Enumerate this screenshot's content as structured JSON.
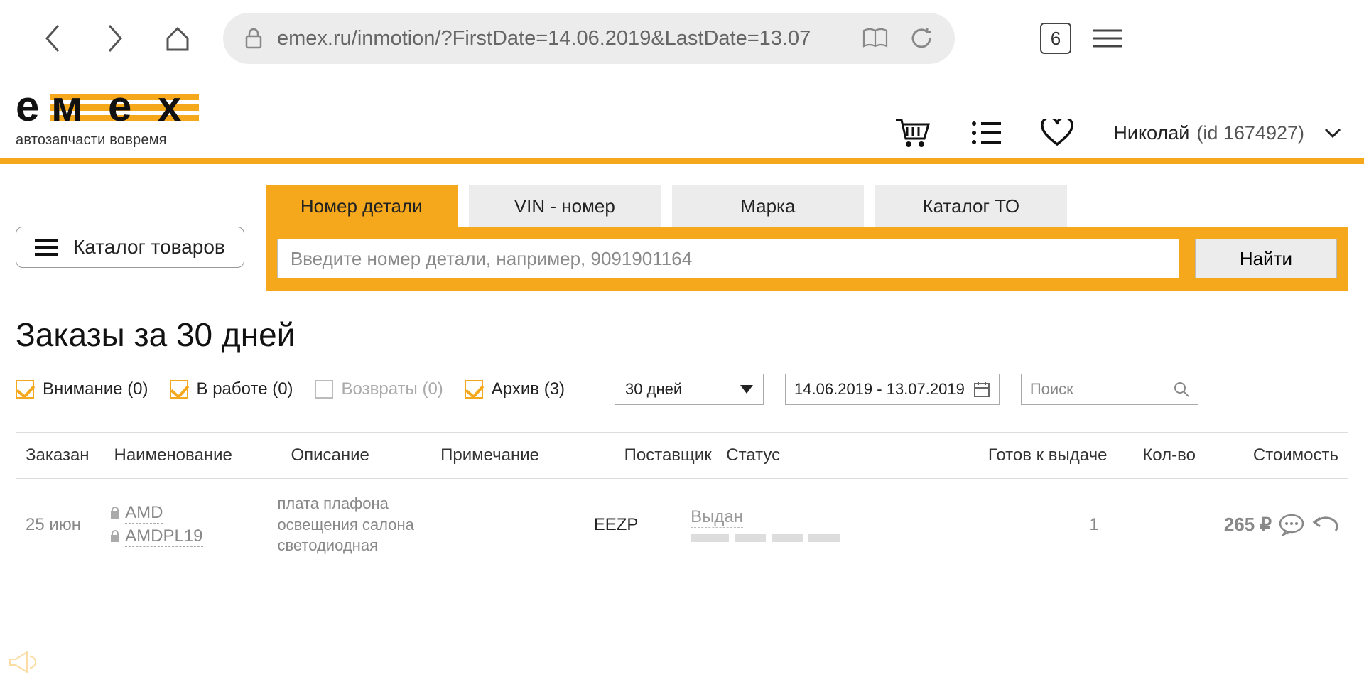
{
  "browser": {
    "url": "emex.ru/inmotion/?FirstDate=14.06.2019&LastDate=13.07",
    "tab_count": "6"
  },
  "logo": {
    "text": "емех",
    "tagline": "автозапчасти вовремя"
  },
  "header": {
    "user_name": "Николай",
    "user_id": "(id 1674927)"
  },
  "catalog_button": "Каталог товаров",
  "tabs": [
    "Номер детали",
    "VIN - номер",
    "Марка",
    "Каталог ТО"
  ],
  "search": {
    "placeholder": "Введите номер детали, например, 9091901164",
    "button": "Найти"
  },
  "page_title": "Заказы за 30 дней",
  "filters": {
    "attention": "Внимание (0)",
    "in_work": "В работе (0)",
    "returns": "Возвраты (0)",
    "archive": "Архив (3)",
    "period": "30 дней",
    "date_range": "14.06.2019 - 13.07.2019",
    "search_placeholder": "Поиск"
  },
  "table": {
    "headers": {
      "date": "Заказан",
      "name": "Наименование",
      "desc": "Описание",
      "note": "Примечание",
      "supplier": "Поставщик",
      "status": "Статус",
      "ready": "Готов к выдаче",
      "qty": "Кол-во",
      "cost": "Стоимость"
    },
    "rows": [
      {
        "date": "25 июн",
        "brand": "AMD",
        "sku": "AMDPL19",
        "desc": "плата плафона освещения салона светодиодная",
        "supplier": "EEZP",
        "status": "Выдан",
        "qty": "1",
        "cost": "265 ₽"
      }
    ]
  }
}
